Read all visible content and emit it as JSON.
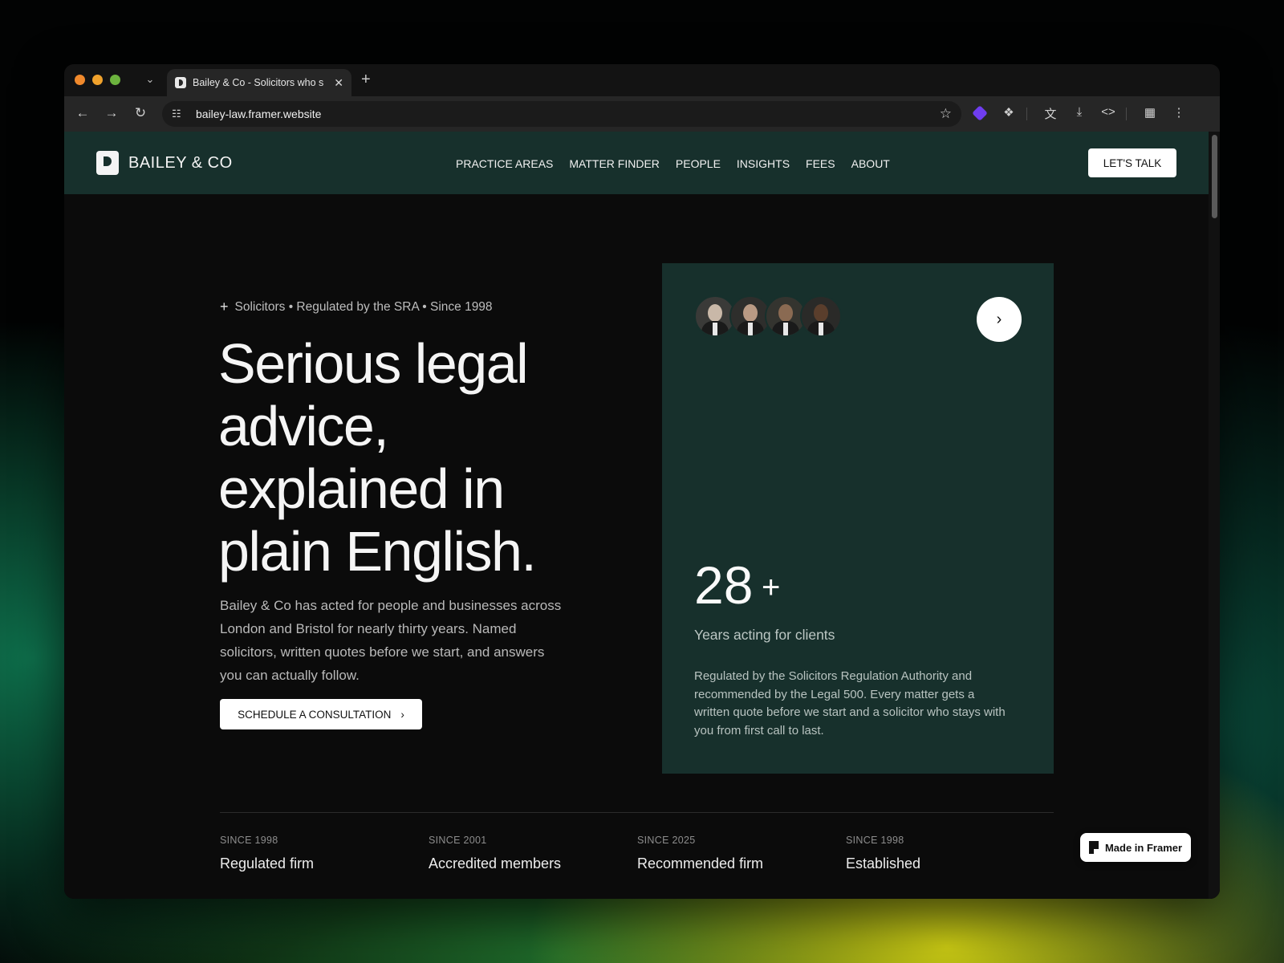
{
  "browser": {
    "tab_title": "Bailey & Co - Solicitors who s",
    "url": "bailey-law.framer.website",
    "traffic_colors": [
      "#f0892c",
      "#f0892c",
      "#6cb33e"
    ]
  },
  "site": {
    "logo_text": "BAILEY & CO",
    "nav": [
      "PRACTICE AREAS",
      "MATTER FINDER",
      "PEOPLE",
      "INSIGHTS",
      "FEES",
      "ABOUT"
    ],
    "cta_label": "LET'S TALK"
  },
  "hero": {
    "eyebrow": "Solicitors • Regulated by the SRA • Since 1998",
    "title": "Serious legal advice, explained in plain English.",
    "body": "Bailey & Co has acted for people and businesses across London and Bristol for nearly thirty years. Named solicitors, written quotes before we start, and answers you can actually follow.",
    "button": "SCHEDULE A CONSULTATION"
  },
  "card": {
    "stat": "28",
    "stat_suffix": "+",
    "stat_label": "Years acting for clients",
    "body": "Regulated by the Solicitors Regulation Authority and recommended by the Legal 500. Every matter gets a written quote before we start and a solicitor who stays with you from first call to last."
  },
  "badges": [
    {
      "since": "SINCE 1998",
      "title": "Regulated firm"
    },
    {
      "since": "SINCE 2001",
      "title": "Accredited members"
    },
    {
      "since": "SINCE 2025",
      "title": "Recommended firm"
    },
    {
      "since": "SINCE 1998",
      "title": "Established"
    }
  ],
  "framer_badge": "Made in Framer",
  "colors": {
    "brand_green": "#17302c",
    "page_bg": "#0b0b0b"
  }
}
